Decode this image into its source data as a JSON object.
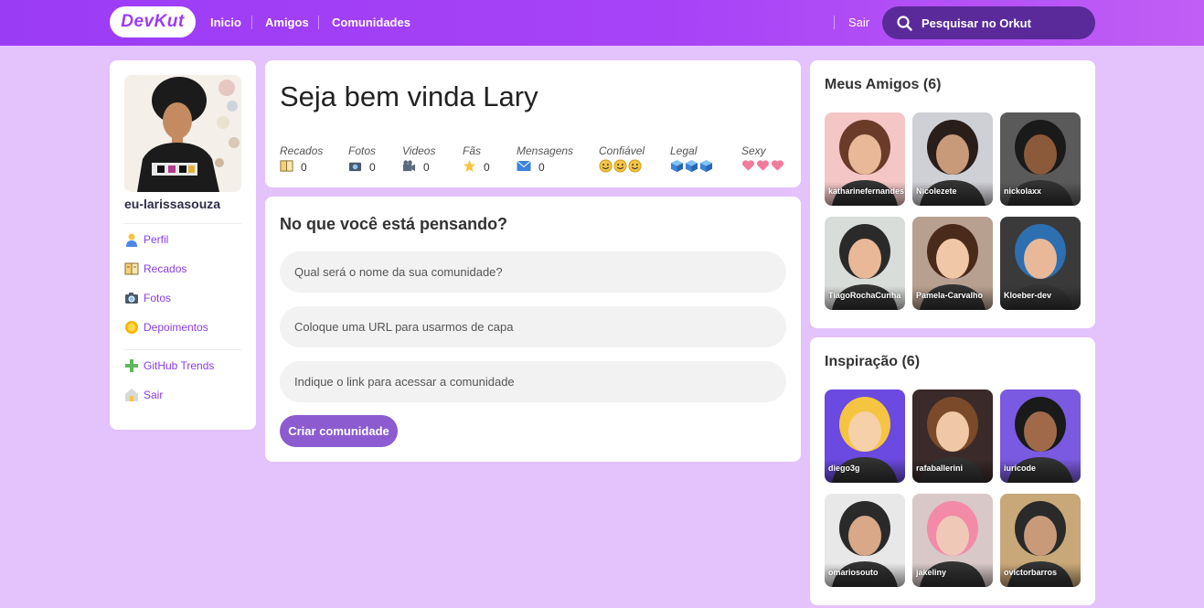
{
  "brand": {
    "logo": "DevKut",
    "accent": "#9b3cf5"
  },
  "nav": {
    "links": [
      "Inicio",
      "Amigos",
      "Comunidades"
    ],
    "logout": "Sair",
    "search_placeholder": "Pesquisar no Orkut"
  },
  "sidebar": {
    "username": "eu-larissasouza",
    "items": [
      {
        "label": "Perfil",
        "icon": "user-icon"
      },
      {
        "label": "Recados",
        "icon": "book-icon"
      },
      {
        "label": "Fotos",
        "icon": "camera-icon"
      },
      {
        "label": "Depoimentos",
        "icon": "sun-icon"
      }
    ],
    "extra": [
      {
        "label": "GitHub Trends",
        "icon": "plus-icon"
      },
      {
        "label": "Sair",
        "icon": "exit-icon"
      }
    ]
  },
  "welcome": {
    "title": "Seja bem vinda Lary",
    "stats": [
      {
        "label": "Recados",
        "value": "0",
        "icon": "book-icon"
      },
      {
        "label": "Fotos",
        "value": "0",
        "icon": "camera-icon"
      },
      {
        "label": "Videos",
        "value": "0",
        "icon": "video-camera-icon"
      },
      {
        "label": "Fãs",
        "value": "0",
        "icon": "star-icon"
      },
      {
        "label": "Mensagens",
        "value": "0",
        "icon": "envelope-icon"
      },
      {
        "label": "Confiável",
        "rating": 3,
        "icon": "smiley-icon"
      },
      {
        "label": "Legal",
        "rating": 3,
        "icon": "ice-cube-icon"
      },
      {
        "label": "Sexy",
        "rating": 3,
        "icon": "heart-icon"
      }
    ]
  },
  "form": {
    "title": "No que você está pensando?",
    "fields": [
      "Qual será o nome da sua comunidade?",
      "Coloque uma URL para usarmos de capa",
      "Indique o link para acessar a comunidade"
    ],
    "submit": "Criar comunidade"
  },
  "friends": {
    "title": "Meus Amigos (6)",
    "items": [
      "katharinefernandes",
      "Nicolezete",
      "nickolaxx",
      "TiagoRochaCunha",
      "Pamela-Carvalho",
      "Kloeber-dev"
    ]
  },
  "inspiration": {
    "title": "Inspiração (6)",
    "items": [
      "diego3g",
      "rafaballerini",
      "iuricode",
      "omariosouto",
      "jakeliny",
      "ovictorbarros"
    ]
  }
}
